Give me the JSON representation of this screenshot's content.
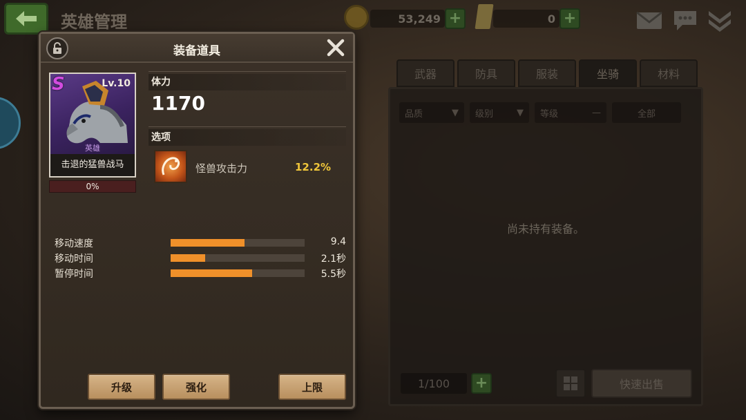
{
  "screen": {
    "title": "英雄管理",
    "gold": "53,249",
    "tickets": "0",
    "tabs": [
      "武器",
      "防具",
      "服装",
      "坐骑",
      "材料"
    ],
    "active_tab": "坐骑",
    "filters": {
      "quality": "品质",
      "level": "级别",
      "grade": "等级",
      "all": "全部"
    },
    "empty_message": "尚未持有装备。",
    "capacity": "1/100",
    "quick_sell": "快速出售"
  },
  "modal": {
    "title": "装备道具",
    "item": {
      "grade": "S",
      "level": "Lv.10",
      "rank": "英雄",
      "name": "击退的猛兽战马",
      "progress_text": "0%",
      "progress": 0
    },
    "stamina": {
      "label": "体力",
      "value": "1170"
    },
    "options": {
      "label": "选项",
      "items": [
        {
          "name": "怪兽攻击力",
          "value": "12.2%"
        }
      ]
    },
    "stats": [
      {
        "label": "移动速度",
        "value": "9.4",
        "fraction": 0.55
      },
      {
        "label": "移动时间",
        "value": "2.1秒",
        "fraction": 0.26
      },
      {
        "label": "暂停时间",
        "value": "5.5秒",
        "fraction": 0.61
      }
    ],
    "buttons": {
      "upgrade": "升级",
      "enhance": "强化",
      "limit": "上限"
    }
  },
  "colors": {
    "accent_orange": "#f0902a",
    "option_value": "#f0c63a",
    "grade_s": "#d24ce0",
    "button_face": "#c9a272"
  }
}
